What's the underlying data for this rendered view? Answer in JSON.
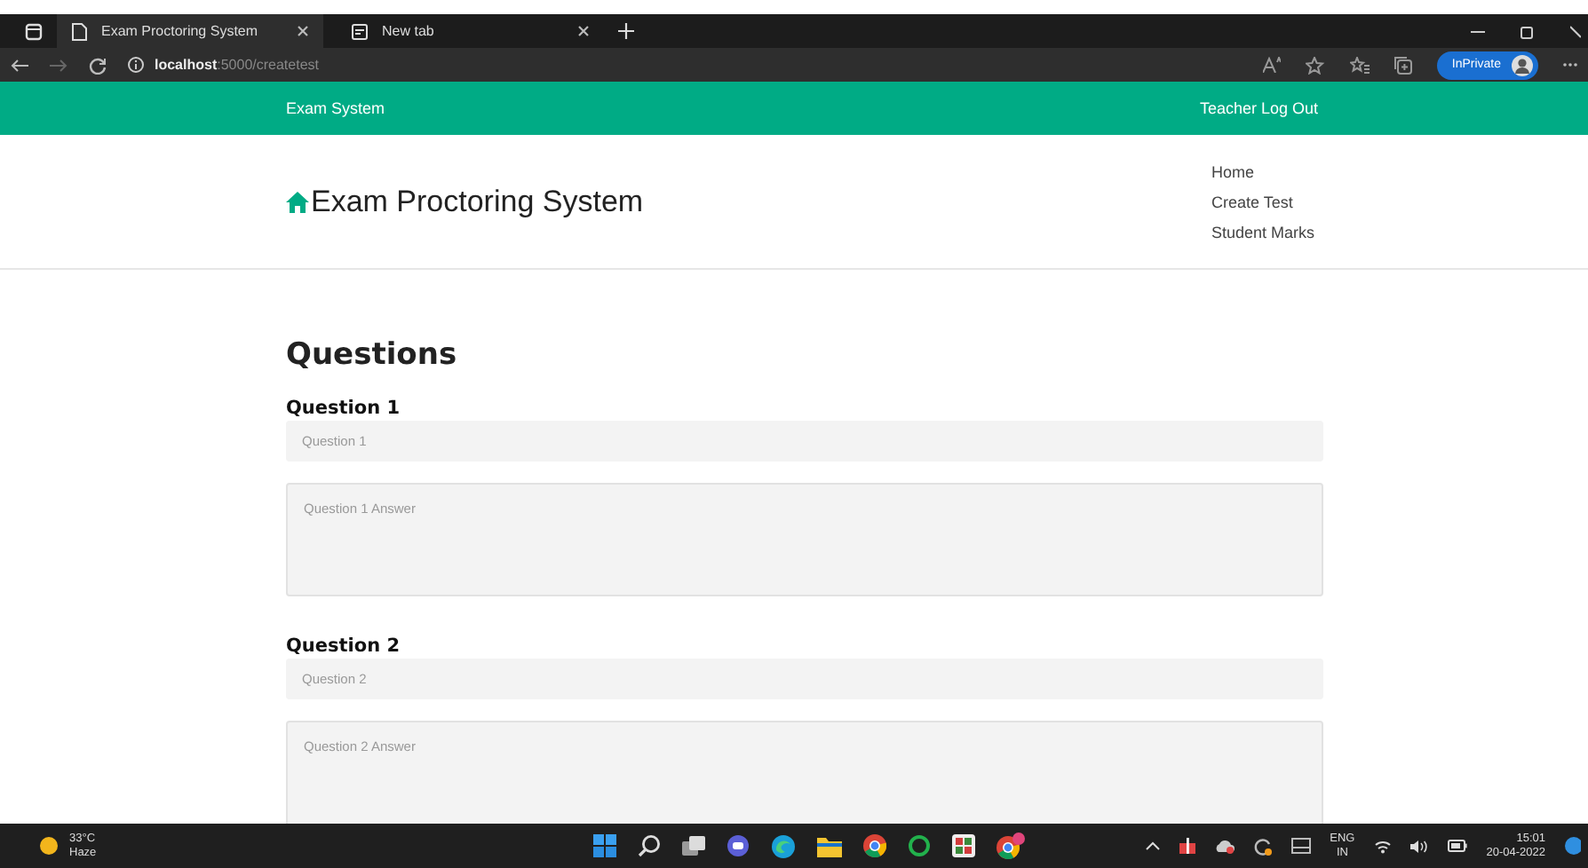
{
  "browser": {
    "tabs": [
      {
        "title": "Exam Proctoring System",
        "selected": true
      },
      {
        "title": "New tab",
        "selected": false
      }
    ],
    "address": {
      "host": "localhost",
      "path": ":5000/createtest"
    },
    "profile_label": "InPrivate"
  },
  "navbar": {
    "brand": "Exam System",
    "logout": "Teacher Log Out"
  },
  "header": {
    "title": "Exam Proctoring System",
    "menu": [
      "Home",
      "Create Test",
      "Student Marks"
    ]
  },
  "content": {
    "heading": "Questions",
    "questions": [
      {
        "label": "Question 1",
        "placeholder": "Question 1",
        "answer_placeholder": "Question 1 Answer"
      },
      {
        "label": "Question 2",
        "placeholder": "Question 2",
        "answer_placeholder": "Question 2 Answer"
      }
    ]
  },
  "taskbar": {
    "weather": {
      "temperature": "33°C",
      "condition": "Haze"
    },
    "language": {
      "code": "ENG",
      "region": "IN"
    },
    "clock": {
      "time": "15:01",
      "date": "20-04-2022"
    }
  }
}
